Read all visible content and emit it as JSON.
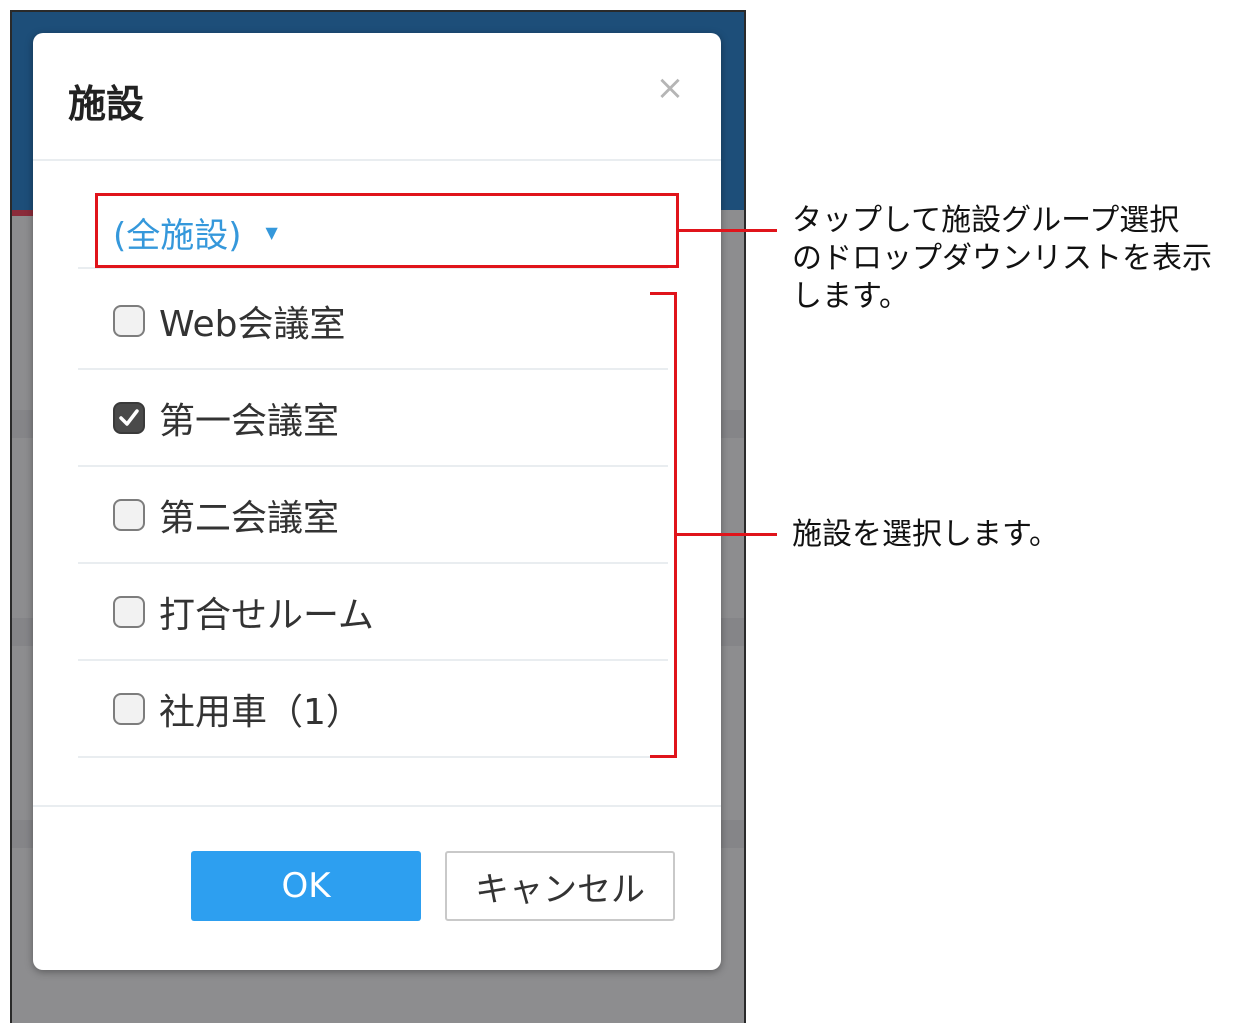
{
  "modal": {
    "title": "施設",
    "close_icon": "close-icon",
    "group_select": {
      "label": "(全施設)",
      "caret_icon": "caret-down-icon"
    },
    "facilities": [
      {
        "label": "Web会議室",
        "checked": false
      },
      {
        "label": "第一会議室",
        "checked": true
      },
      {
        "label": "第二会議室",
        "checked": false
      },
      {
        "label": "打合せルーム",
        "checked": false
      },
      {
        "label": "社用車（1）",
        "checked": false
      }
    ],
    "buttons": {
      "ok": "OK",
      "cancel": "キャンセル"
    }
  },
  "annotations": {
    "group_select_note": [
      "タップして施設グループ選択",
      "のドロップダウンリストを表示",
      "します。"
    ],
    "facility_note": "施設を選択します。"
  },
  "colors": {
    "accent_blue": "#3598db",
    "ok_button": "#2d9ff0",
    "annotation_red": "#e0141b",
    "header_bg": "#1d4e79"
  }
}
